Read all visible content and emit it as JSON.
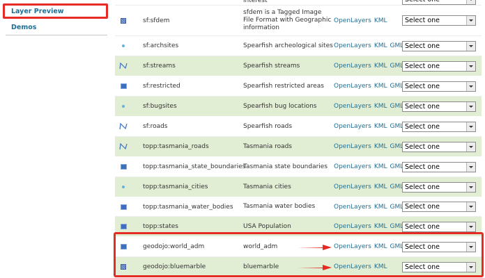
{
  "sidebar": {
    "items": [
      {
        "label": "Layer Preview"
      },
      {
        "label": "Demos"
      }
    ]
  },
  "select_placeholder": "Select one",
  "top_partial_text": "interest",
  "rows": [
    {
      "icon": "raster-icon",
      "name": "sf:sfdem",
      "title": "sfdem is a Tagged Image File Format with Geographic information",
      "links": [
        "OpenLayers",
        "KML"
      ],
      "style": "plain"
    },
    {
      "icon": "point-icon",
      "name": "sf:archsites",
      "title": "Spearfish archeological sites",
      "links": [
        "OpenLayers",
        "KML",
        "GML"
      ],
      "style": "plain"
    },
    {
      "icon": "line-icon",
      "name": "sf:streams",
      "title": "Spearfish streams",
      "links": [
        "OpenLayers",
        "KML",
        "GML"
      ],
      "style": "alt"
    },
    {
      "icon": "polygon-icon",
      "name": "sf:restricted",
      "title": "Spearfish restricted areas",
      "links": [
        "OpenLayers",
        "KML",
        "GML"
      ],
      "style": "plain"
    },
    {
      "icon": "point-icon",
      "name": "sf:bugsites",
      "title": "Spearfish bug locations",
      "links": [
        "OpenLayers",
        "KML",
        "GML"
      ],
      "style": "alt"
    },
    {
      "icon": "line-icon",
      "name": "sf:roads",
      "title": "Spearfish roads",
      "links": [
        "OpenLayers",
        "KML",
        "GML"
      ],
      "style": "plain"
    },
    {
      "icon": "line-icon",
      "name": "topp:tasmania_roads",
      "title": "Tasmania roads",
      "links": [
        "OpenLayers",
        "KML",
        "GML"
      ],
      "style": "alt"
    },
    {
      "icon": "polygon-icon",
      "name": "topp:tasmania_state_boundaries",
      "title": "Tasmania state boundaries",
      "links": [
        "OpenLayers",
        "KML",
        "GML"
      ],
      "style": "plain"
    },
    {
      "icon": "point-icon",
      "name": "topp:tasmania_cities",
      "title": "Tasmania cities",
      "links": [
        "OpenLayers",
        "KML",
        "GML"
      ],
      "style": "alt"
    },
    {
      "icon": "polygon-icon",
      "name": "topp:tasmania_water_bodies",
      "title": "Tasmania water bodies",
      "links": [
        "OpenLayers",
        "KML",
        "GML"
      ],
      "style": "plain"
    },
    {
      "icon": "polygon-icon",
      "name": "topp:states",
      "title": "USA Population",
      "links": [
        "OpenLayers",
        "KML",
        "GML"
      ],
      "style": "alt"
    },
    {
      "icon": "polygon-icon",
      "name": "geodojo:world_adm",
      "title": "world_adm",
      "links": [
        "OpenLayers",
        "KML",
        "GML"
      ],
      "style": "plain"
    },
    {
      "icon": "raster-icon",
      "name": "geodojo:bluemarble",
      "title": "bluemarble",
      "links": [
        "OpenLayers",
        "KML"
      ],
      "style": "alt"
    }
  ],
  "colors": {
    "accent": "#1d6f96",
    "row_alt": "#e2eed4",
    "highlight": "#e52b24"
  }
}
